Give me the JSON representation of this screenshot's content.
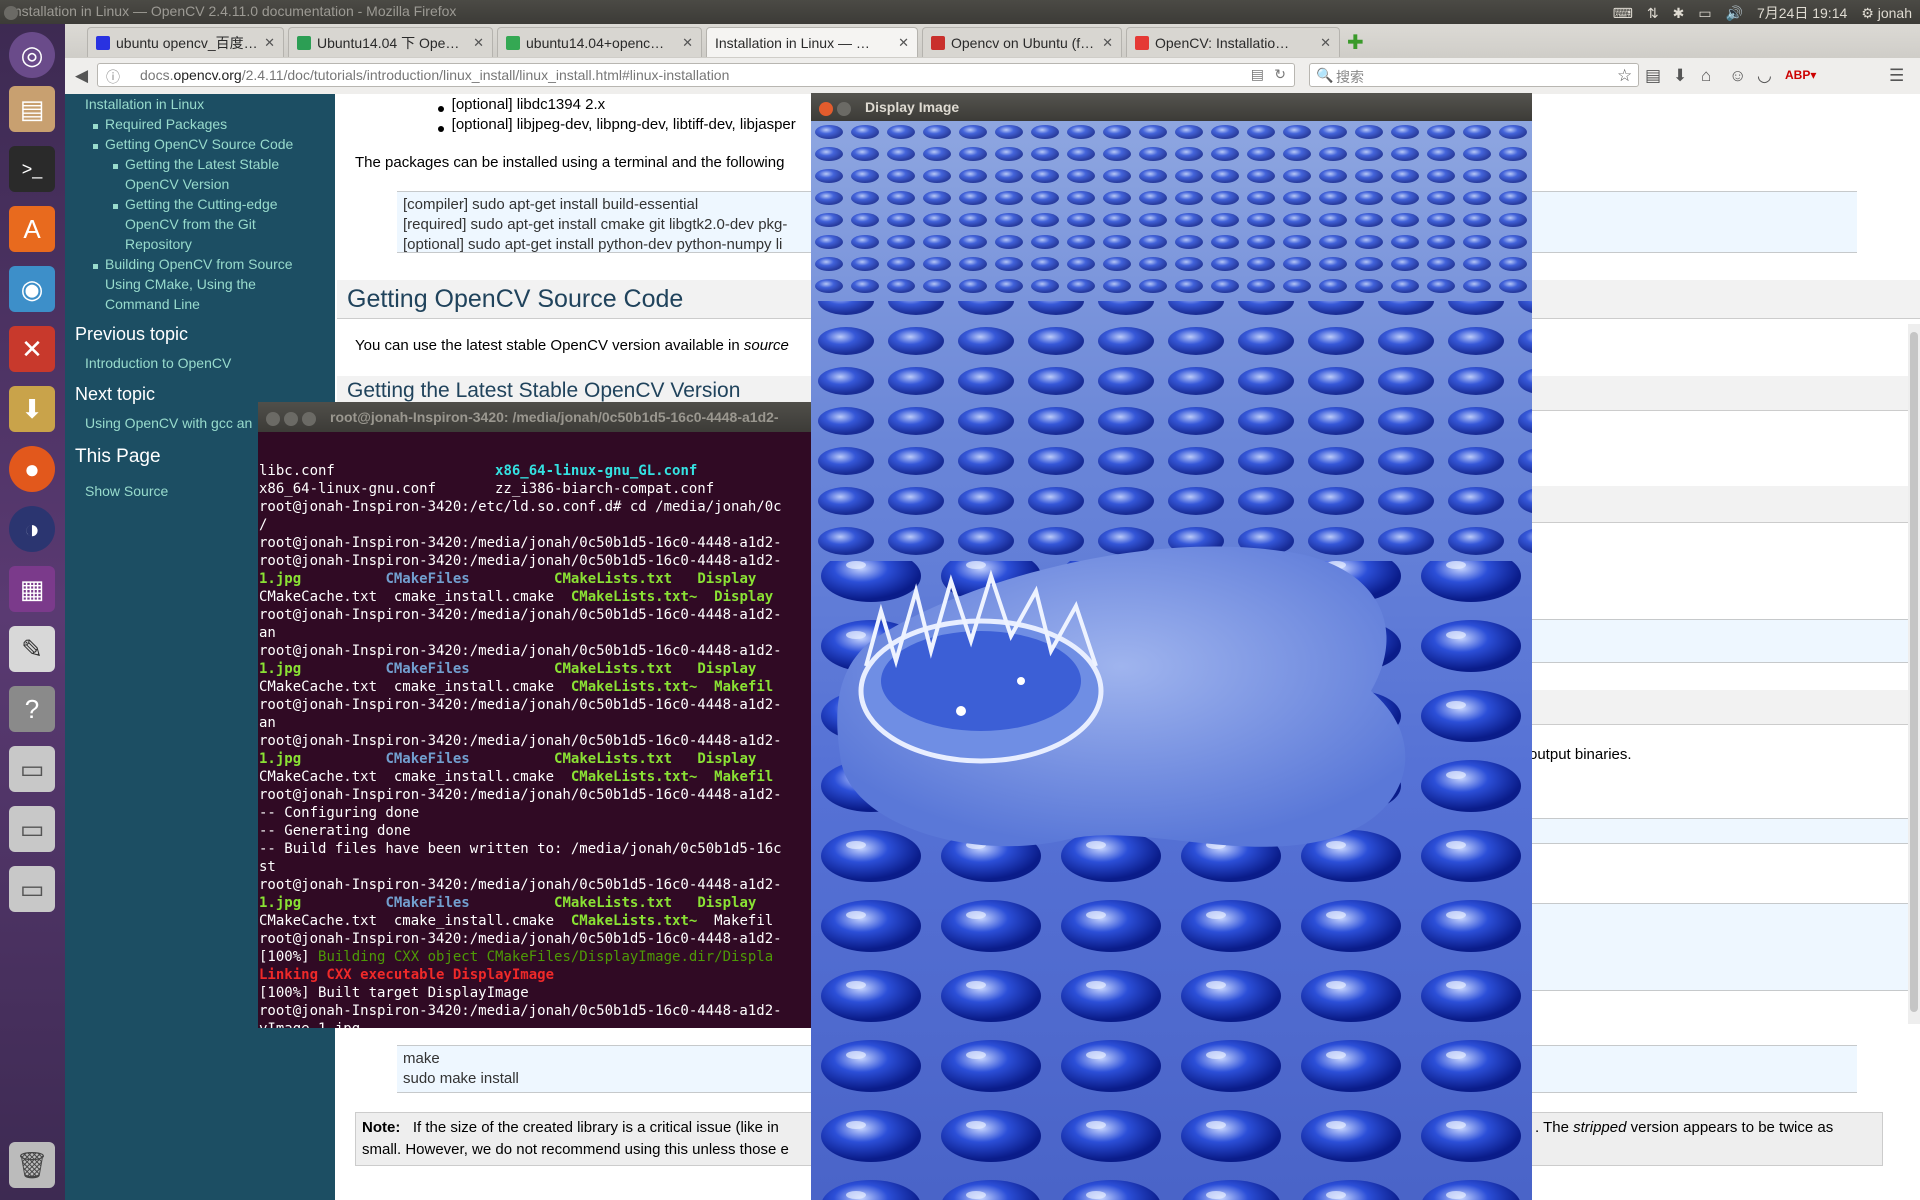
{
  "window_title": "Installation in Linux — OpenCV 2.4.11.0 documentation - Mozilla Firefox",
  "tray": {
    "keyboard": "⌨",
    "network": "⇅",
    "bluetooth": "✱",
    "battery": "▭",
    "volume": "🔊",
    "datetime": "7月24日 19:14",
    "user": "jonah"
  },
  "tabs": [
    {
      "label": "ubuntu opencv_百度…",
      "color": "#2932e1"
    },
    {
      "label": "Ubuntu14.04 下 Ope…",
      "color": "#2c9e54"
    },
    {
      "label": "ubuntu14.04+openc…",
      "color": "#34a853"
    },
    {
      "label": "Installation in Linux — …",
      "color": "#ffffff",
      "active": true
    },
    {
      "label": "Opencv on Ubuntu (f…",
      "color": "#c9302c"
    },
    {
      "label": "OpenCV: Installatio…",
      "color": "#e53935"
    }
  ],
  "nav": {
    "url_prefix": "docs.",
    "url_domain": "opencv.org",
    "url_rest": "/2.4.11/doc/tutorials/introduction/linux_install/linux_install.html#linux-installation",
    "search_placeholder": "搜索"
  },
  "sidebar": {
    "top_item": "Installation in Linux",
    "items": [
      "Required Packages",
      "Getting OpenCV Source Code",
      "Getting the Latest Stable",
      "OpenCV Version",
      "Getting the Cutting-edge",
      "OpenCV from the Git",
      "Repository",
      "Building OpenCV from Source",
      "Using CMake, Using the",
      "Command Line"
    ],
    "prev_heading": "Previous topic",
    "prev_link": "Introduction to OpenCV",
    "next_heading": "Next topic",
    "next_link": "Using OpenCV with gcc an",
    "this_page_heading": "This Page",
    "show_source": "Show Source"
  },
  "content": {
    "bullet1": "[optional] libdc1394 2.x",
    "bullet2": "[optional] libjpeg-dev, libpng-dev, libtiff-dev, libjasper",
    "packages_text": "The packages can be installed using a terminal and the following",
    "pre1": [
      "[compiler] sudo apt-get install build-essential",
      "[required] sudo apt-get install cmake git libgtk2.0-dev pkg-",
      "[optional] sudo apt-get install python-dev python-numpy li"
    ],
    "h2_source": "Getting OpenCV Source Code",
    "p_source_a": "You can use the latest stable OpenCV version available in ",
    "p_source_b": "source",
    "h3_latest": "Getting the Latest Stable OpenCV Version",
    "output_binaries": "output binaries.",
    "pre_make": [
      "make",
      "sudo make install"
    ],
    "note_label": "Note:",
    "note_a": "If the size of the created library is a critical issue (like in",
    "note_b": ". The ",
    "note_c": "stripped",
    "note_d": " version appears to be twice as",
    "note_line2": "small. However, we do not recommend using this unless those e"
  },
  "terminal": {
    "title": "root@jonah-Inspiron-3420: /media/jonah/0c50b1d5-16c0-4448-a1d2-"
  },
  "image_window": {
    "title": "Display Image"
  }
}
